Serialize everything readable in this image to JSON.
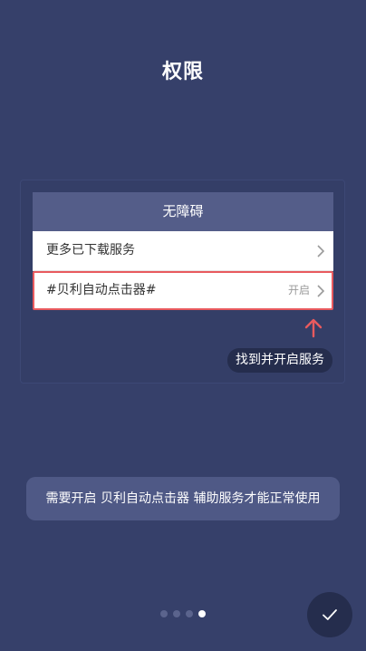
{
  "page": {
    "title": "权限"
  },
  "demo": {
    "header": "无障碍",
    "rows": [
      {
        "label": "更多已下载服务",
        "status": "",
        "icon": "chevron-right-icon"
      },
      {
        "label": "#贝利自动点击器#",
        "status": "开启",
        "icon": "chevron-right-icon"
      }
    ],
    "arrow_icon": "arrow-up-icon",
    "tip": "找到并开启服务",
    "highlight_color": "#e85a5e"
  },
  "notice": {
    "text": "需要开启 贝利自动点击器 辅助服务才能正常使用"
  },
  "pager": {
    "total": 4,
    "current": 4
  },
  "done_button": {
    "icon": "checkmark-icon"
  },
  "colors": {
    "background": "#36406a",
    "panel_header": "#545d89",
    "notice_bg": "#4f5986",
    "dark_accent": "#252d4d"
  }
}
